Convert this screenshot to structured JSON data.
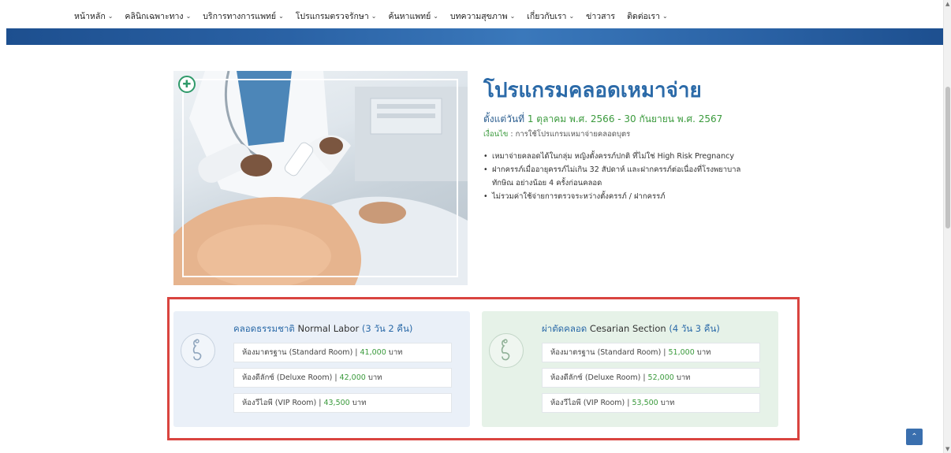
{
  "nav": {
    "items": [
      {
        "label": "หน้าหลัก",
        "dropdown": true
      },
      {
        "label": "คลินิกเฉพาะทาง",
        "dropdown": true
      },
      {
        "label": "บริการทางการแพทย์",
        "dropdown": true
      },
      {
        "label": "โปรแกรมตรวจรักษา",
        "dropdown": true
      },
      {
        "label": "ค้นหาแพทย์",
        "dropdown": true
      },
      {
        "label": "บทความสุขภาพ",
        "dropdown": true
      },
      {
        "label": "เกี่ยวกับเรา",
        "dropdown": true
      },
      {
        "label": "ข่าวสาร",
        "dropdown": false
      },
      {
        "label": "ติดต่อเรา",
        "dropdown": true
      }
    ]
  },
  "program": {
    "title": "โปรแกรมคลอดเหมาจ่าย",
    "date_prefix": "ตั้งแต่วันที่ ",
    "date_range": "1 ตุลาคม พ.ศ. 2566 - 30 กันยายน พ.ศ. 2567",
    "condition_label": "เงื่อนไข",
    "condition_text": " : การใช้โปรแกรมเหมาจ่ายคลอดบุตร",
    "bullets": [
      "เหมาจ่ายคลอดได้ในกลุ่ม หญิงตั้งครรภ์ปกติ ที่ไม่ใช่ High Risk Pregnancy",
      "ฝากครรภ์เมื่ออายุครรภ์ไม่เกิน 32 สัปดาห์ และฝากครรภ์ต่อเนื่องที่โรงพยาบาลทักษิณ อย่างน้อย 4 ครั้งก่อนคลอด",
      "ไม่รวมค่าใช้จ่ายการตรวจระหว่างตั้งครรภ์ / ฝากครรภ์"
    ]
  },
  "packages": [
    {
      "title_th": "คลอดธรรมชาติ",
      "title_en": " Normal Labor ",
      "nights": "(3 วัน 2 คืน)",
      "rooms": [
        {
          "label": "ห้องมาตรฐาน (Standard Room) | ",
          "price": "41,000",
          "unit": " บาท"
        },
        {
          "label": "ห้องดีลักซ์ (Deluxe Room) | ",
          "price": "42,000",
          "unit": " บาท"
        },
        {
          "label": "ห้องวีไอพี (VIP Room) | ",
          "price": "43,500",
          "unit": " บาท"
        }
      ]
    },
    {
      "title_th": "ผ่าตัดคลอด",
      "title_en": " Cesarian Section ",
      "nights": "(4 วัน 3 คืน)",
      "rooms": [
        {
          "label": "ห้องมาตรฐาน (Standard Room) | ",
          "price": "51,000",
          "unit": " บาท"
        },
        {
          "label": "ห้องดีลักซ์ (Deluxe Room) | ",
          "price": "52,000",
          "unit": " บาท"
        },
        {
          "label": "ห้องวีไอพี (VIP Room) | ",
          "price": "53,500",
          "unit": " บาท"
        }
      ]
    }
  ],
  "colors": {
    "brand_blue": "#2b6aa8",
    "accent_green": "#3a9a3c",
    "highlight_red": "#d9443f",
    "card_blue_bg": "#eaf0f8",
    "card_green_bg": "#e6f2e8"
  },
  "icons": {
    "nav_dropdown": "chevron-down-icon",
    "badge": "medical-cross-icon",
    "package": "pregnancy-icon",
    "back_to_top": "chevrons-up-icon"
  }
}
